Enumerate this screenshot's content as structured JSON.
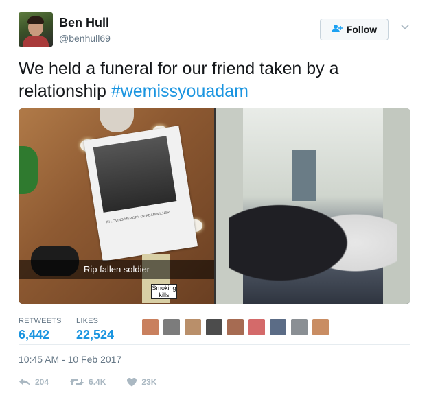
{
  "user": {
    "name": "Ben Hull",
    "handle": "@benhull69"
  },
  "follow_label": "Follow",
  "tweet": {
    "text": "We held a funeral for our friend taken by a relationship ",
    "hashtag": "#wemissyouadam"
  },
  "media": {
    "caption": "Rip fallen soldier",
    "portrait_text": "IN LOVING MEMORY OF ADAM MILNER",
    "pack_text": "Smoking kills"
  },
  "stats": {
    "retweets_label": "RETWEETS",
    "retweets_value": "6,442",
    "likes_label": "LIKES",
    "likes_value": "22,524"
  },
  "liker_avatars": [
    "#c9805e",
    "#7c7c7c",
    "#b98f6a",
    "#4c4c4c",
    "#a66b52",
    "#d46a6a",
    "#5b6c86",
    "#8a8f94",
    "#c98d63"
  ],
  "timestamp": "10:45 AM - 10 Feb 2017",
  "actions": {
    "reply_count": "204",
    "retweet_count": "6.4K",
    "like_count": "23K"
  },
  "colors": {
    "link": "#1b95e0",
    "follow_icon": "#1da1f2",
    "muted": "#657786"
  }
}
